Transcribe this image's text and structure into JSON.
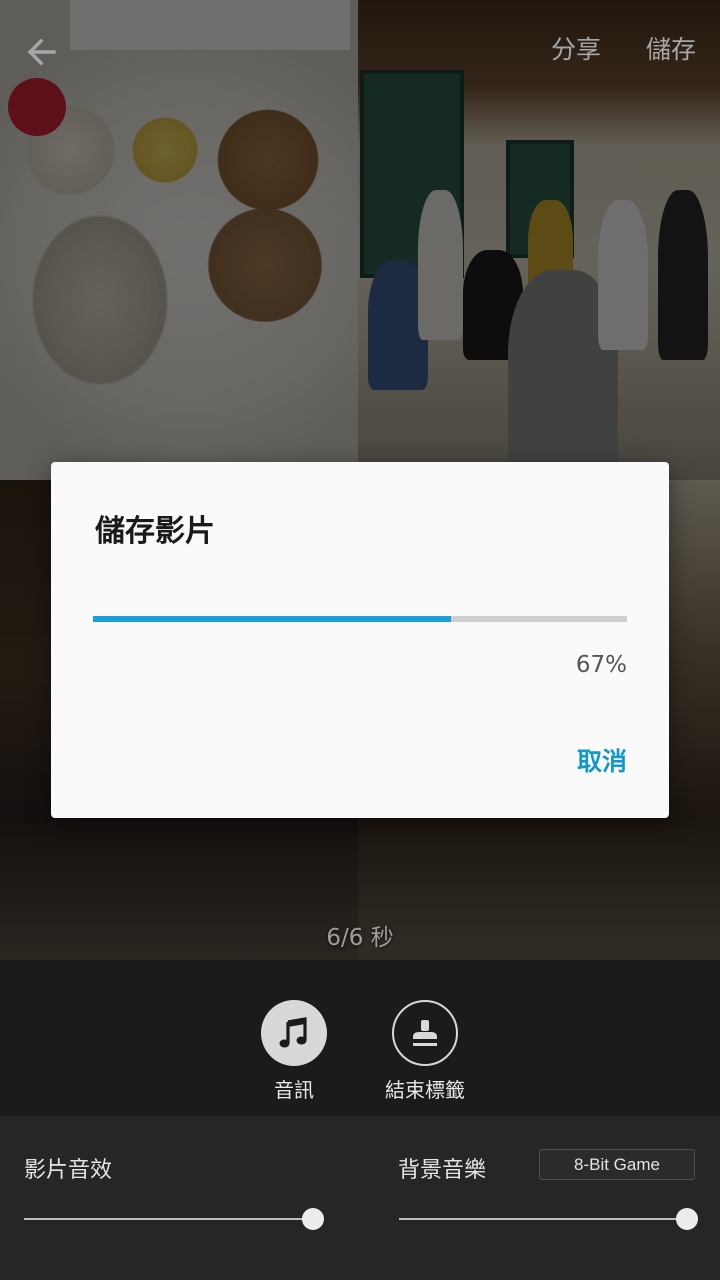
{
  "topbar": {
    "share_label": "分享",
    "save_label": "儲存"
  },
  "preview": {
    "time_label": "6/6 秒"
  },
  "dialog": {
    "title": "儲存影片",
    "progress_text": "67%",
    "progress_fraction": 0.67,
    "cancel_label": "取消",
    "accent_color": "#1a9fd4"
  },
  "tools": {
    "audio_label": "音訊",
    "endtag_label": "結束標籤"
  },
  "mixer": {
    "video_sfx_label": "影片音效",
    "video_sfx_level": 1.0,
    "bgm_label": "背景音樂",
    "bgm_track": "8-Bit Game",
    "bgm_level": 1.0
  },
  "icons": {
    "back": "arrow-left-icon",
    "audio": "music-note-icon",
    "endtag": "stamp-icon"
  }
}
